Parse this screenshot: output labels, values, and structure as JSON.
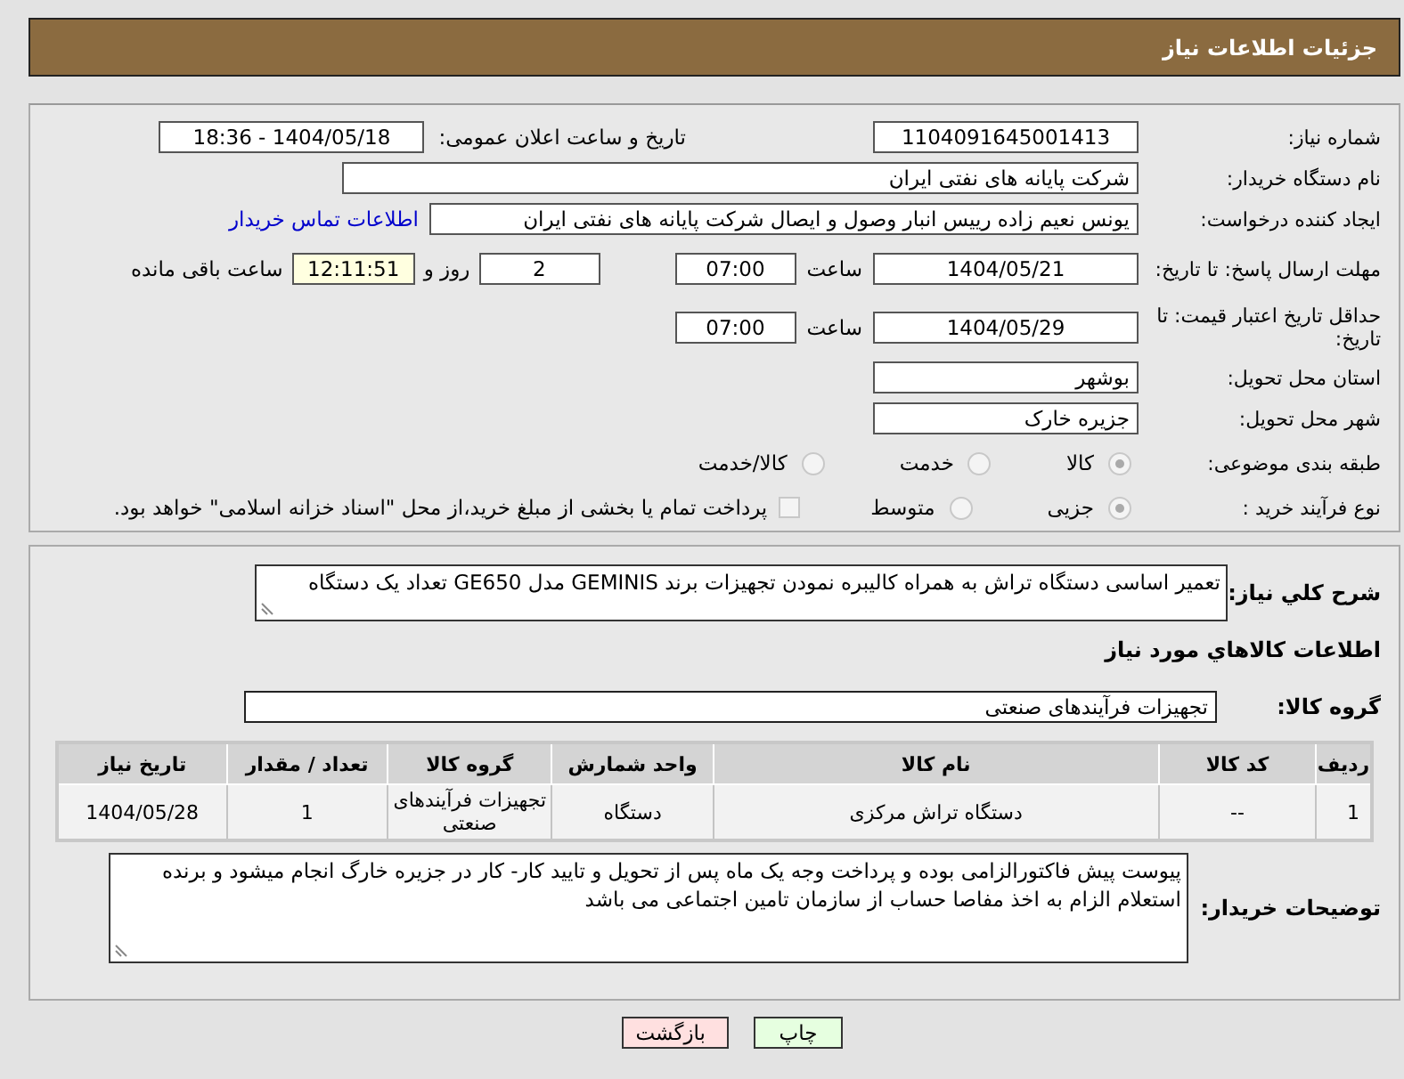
{
  "header": {
    "title": "جزئیات اطلاعات نیاز"
  },
  "need_number": {
    "label": "شماره نیاز:",
    "value": "1104091645001413"
  },
  "announce": {
    "label": "تاریخ و ساعت اعلان عمومی:",
    "value": "1404/05/18 - 18:36"
  },
  "buyer": {
    "label": "نام دستگاه خریدار:",
    "value": "شرکت پایانه های نفتی ایران"
  },
  "creator": {
    "label": "ایجاد کننده درخواست:",
    "value": "یونس نعیم زاده رییس انبار وصول و ایصال شرکت پایانه های نفتی ایران",
    "link": "اطلاعات تماس خریدار"
  },
  "deadline": {
    "label": "مهلت ارسال پاسخ: تا تاریخ:",
    "date": "1404/05/21",
    "time_label": "ساعت",
    "time": "07:00",
    "days": "2",
    "days_label": "روز و",
    "remaining": "12:11:51",
    "remaining_label": "ساعت باقی مانده"
  },
  "validity": {
    "label": "حداقل تاریخ اعتبار قیمت: تا تاریخ:",
    "date": "1404/05/29",
    "time_label": "ساعت",
    "time": "07:00"
  },
  "province": {
    "label": "استان محل تحویل:",
    "value": "بوشهر"
  },
  "city": {
    "label": "شهر محل تحویل:",
    "value": "جزیره خارک"
  },
  "category": {
    "label": "طبقه بندی موضوعی:",
    "options": [
      {
        "label": "کالا",
        "selected": true
      },
      {
        "label": "خدمت",
        "selected": false
      },
      {
        "label": "کالا/خدمت",
        "selected": false
      }
    ]
  },
  "process": {
    "label": "نوع فرآیند خرید :",
    "options": [
      {
        "label": "جزیی",
        "selected": true
      },
      {
        "label": "متوسط",
        "selected": false
      }
    ],
    "payment": {
      "label": "پرداخت تمام یا بخشی از مبلغ خرید،از محل \"اسناد خزانه اسلامی\" خواهد بود.",
      "checked": false
    }
  },
  "description": {
    "label": "شرح کلي نیاز:",
    "value": "تعمیر اساسی دستگاه تراش به همراه کالیبره نمودن تجهیزات برند GEMINIS مدل GE650 تعداد یک دستگاه"
  },
  "goods": {
    "title": "اطلاعات کالاهاي مورد نیاز",
    "group_label": "گروه کالا:",
    "group": "تجهیزات فرآیندهای صنعتی",
    "table": {
      "columns": [
        "ردیف",
        "کد کالا",
        "نام کالا",
        "واحد شمارش",
        "گروه کالا",
        "تعداد / مقدار",
        "تاریخ نیاز"
      ],
      "rows": [
        [
          "1",
          "--",
          "دستگاه تراش مرکزی",
          "دستگاه",
          "تجهیزات فرآیندهای صنعتی",
          "1",
          "1404/05/28"
        ]
      ]
    }
  },
  "notes": {
    "label": "توضیحات خریدار:",
    "value": "پیوست پیش فاکتورالزامی بوده و پرداخت وجه یک ماه پس از تحویل و تایید کار- کار در جزیره خارگ انجام میشود و برنده استعلام الزام به اخذ مفاصا حساب از سازمان تامین اجتماعی می باشد"
  },
  "buttons": [
    {
      "label": "چاپ",
      "kind": "print"
    },
    {
      "label": "بازگشت",
      "kind": "back"
    }
  ]
}
